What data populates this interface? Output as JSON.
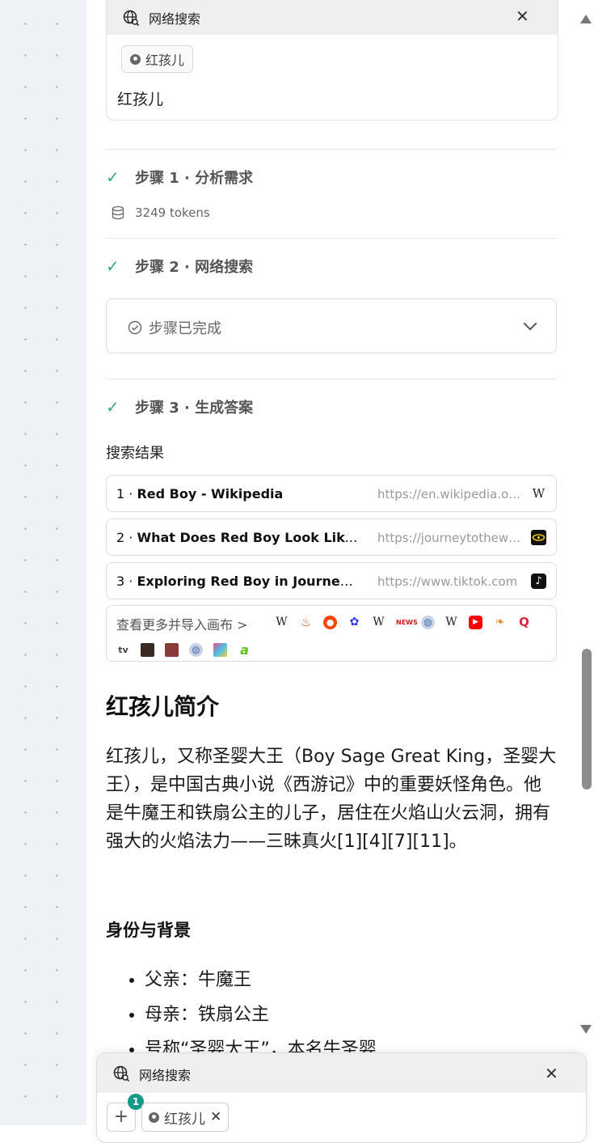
{
  "top_card": {
    "title": "网络搜索",
    "chip_label": "红孩儿",
    "query": "红孩儿"
  },
  "steps": [
    {
      "label": "步骤 1 · 分析需求",
      "tokens": "3249 tokens"
    },
    {
      "label": "步骤 2 · 网络搜索",
      "status": "步骤已完成"
    },
    {
      "label": "步骤 3 · 生成答案"
    }
  ],
  "results": {
    "title": "搜索结果",
    "items": [
      {
        "index": "1 · ",
        "title": "Red Boy - Wikipedia",
        "url": "https://en.wikipedia.org/wiki/Red_Boy",
        "favicon": "W"
      },
      {
        "index": "2 · ",
        "title": "What Does Red Boy Look Like? A Guide",
        "url": "https://journeytothewest",
        "favicon": "eye"
      },
      {
        "index": "3 · ",
        "title": "Exploring Red Boy in Journey to the West",
        "url": "https://www.tiktok.com",
        "favicon": "tiktok"
      }
    ],
    "more_label": "查看更多并导入画布 >",
    "source_icons": [
      "wikipedia",
      "fire",
      "reddit",
      "baidu",
      "wikipedia",
      "news",
      "globe",
      "wikipedia",
      "youtube",
      "shrimp",
      "quora",
      "tv",
      "photo",
      "photo",
      "globe",
      "colorful",
      "a-logo"
    ]
  },
  "article": {
    "heading": "红孩儿简介",
    "paragraph": "红孩儿，又称圣婴大王（Boy Sage Great King，圣婴大王），是中国古典小说《西游记》中的重要妖怪角色。他是牛魔王和铁扇公主的儿子，居住在火焰山火云洞，拥有强大的火焰法力——三昧真火[1][4][7][11]。",
    "subheading": "身份与背景",
    "bullets": [
      "父亲：牛魔王",
      "母亲：铁扇公主",
      "号称“圣婴大王”，本名牛圣婴"
    ]
  },
  "bottom_panel": {
    "title": "网络搜索",
    "badge": "1",
    "chip_label": "红孩儿",
    "plus": "+"
  }
}
